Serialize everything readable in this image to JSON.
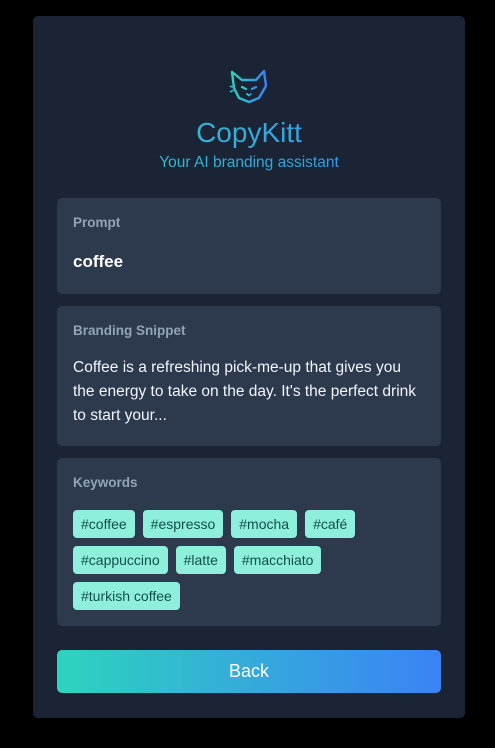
{
  "header": {
    "title": "CopyKitt",
    "subtitle": "Your AI branding assistant",
    "logo_icon": "cat-head-icon"
  },
  "prompt": {
    "label": "Prompt",
    "value": "coffee"
  },
  "snippet": {
    "label": "Branding Snippet",
    "text": "Coffee is a refreshing pick-me-up that gives you the energy to take on the day. It's the perfect drink to start your..."
  },
  "keywords": {
    "label": "Keywords",
    "items": [
      "#coffee",
      "#espresso",
      "#mocha",
      "#café",
      "#cappuccino",
      "#latte",
      "#macchiato",
      "#turkish coffee"
    ]
  },
  "actions": {
    "back_label": "Back"
  },
  "colors": {
    "background": "#000000",
    "card": "#1b2434",
    "panel": "#2d3a4e",
    "label": "#94a3b8",
    "keyword_bg": "#8ef0dc",
    "keyword_text": "#134e4a",
    "gradient_start": "#2dd4bf",
    "gradient_end": "#3b82f6"
  }
}
